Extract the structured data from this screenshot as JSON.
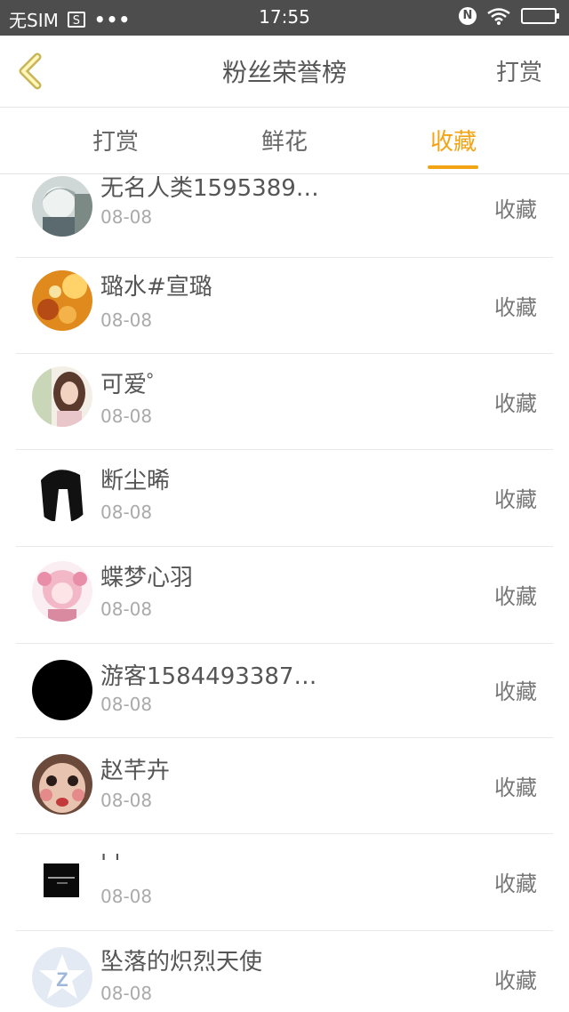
{
  "status_bar": {
    "carrier": "无SIM",
    "sim_icon_text": "S",
    "dots": "•••",
    "time": "17:55",
    "nfc_label": "N",
    "icons": [
      "sim-icon",
      "nfc-icon",
      "wifi-icon",
      "battery-icon"
    ]
  },
  "header": {
    "title": "粉丝荣誉榜",
    "action": "打赏",
    "back_icon": "chevron-left-icon",
    "accent_color": "#f2a415"
  },
  "tabs": [
    {
      "label": "打赏",
      "active": false
    },
    {
      "label": "鲜花",
      "active": false
    },
    {
      "label": "收藏",
      "active": true
    }
  ],
  "fans": [
    {
      "name": "无名人类1595389…",
      "date": "08-08",
      "type": "收藏",
      "avatar": "anime-boy-avatar"
    },
    {
      "name": "璐水#宣璐",
      "date": "08-08",
      "type": "收藏",
      "avatar": "sunset-flowers-avatar"
    },
    {
      "name": "可爱゜",
      "date": "08-08",
      "type": "收藏",
      "avatar": "girl-photo-avatar"
    },
    {
      "name": "断尘晞",
      "date": "08-08",
      "type": "收藏",
      "avatar": "black-hair-silhouette-avatar"
    },
    {
      "name": "蝶梦心羽",
      "date": "08-08",
      "type": "收藏",
      "avatar": "pink-anime-girl-avatar"
    },
    {
      "name": "游客1584493387…",
      "date": "08-08",
      "type": "收藏",
      "avatar": "black-circle-avatar"
    },
    {
      "name": "赵芊卉",
      "date": "08-08",
      "type": "收藏",
      "avatar": "face-photo-avatar"
    },
    {
      "name": "' '",
      "date": "08-08",
      "type": "收藏",
      "avatar": "black-square-logo-avatar"
    },
    {
      "name": "坠落的炽烈天使",
      "date": "08-08",
      "type": "收藏",
      "avatar": "blue-star-default-avatar"
    }
  ]
}
